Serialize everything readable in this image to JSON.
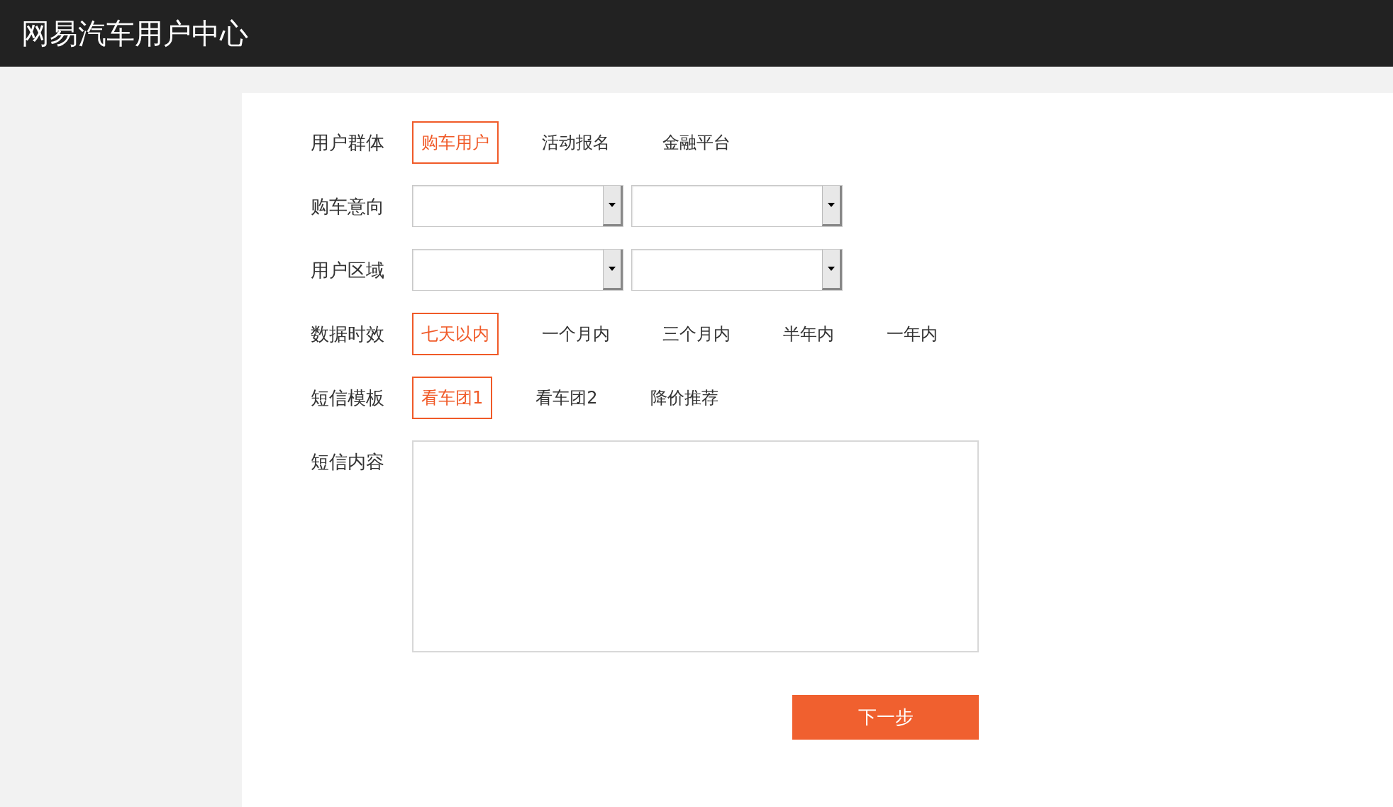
{
  "header": {
    "title": "网易汽车用户中心"
  },
  "form": {
    "rows": [
      {
        "label": "用户群体",
        "kind": "options",
        "options": [
          {
            "label": "购车用户",
            "selected": true
          },
          {
            "label": "活动报名",
            "selected": false
          },
          {
            "label": "金融平台",
            "selected": false
          }
        ]
      },
      {
        "label": "购车意向",
        "kind": "selects",
        "fields": [
          {
            "kind": "dropdown"
          },
          {
            "kind": "dropdown"
          }
        ]
      },
      {
        "label": "用户区域",
        "kind": "selects",
        "fields": [
          {
            "kind": "dropdown"
          },
          {
            "kind": "dropdown"
          }
        ]
      },
      {
        "label": "数据时效",
        "kind": "options",
        "options": [
          {
            "label": "七天以内",
            "selected": true
          },
          {
            "label": "一个月内",
            "selected": false
          },
          {
            "label": "三个月内",
            "selected": false
          },
          {
            "label": "半年内",
            "selected": false
          },
          {
            "label": "一年内",
            "selected": false
          }
        ]
      },
      {
        "label": "短信模板",
        "kind": "options",
        "options": [
          {
            "label": "看车团1",
            "selected": true
          },
          {
            "label": "看车团2",
            "selected": false
          },
          {
            "label": "降价推荐",
            "selected": false
          }
        ]
      },
      {
        "label": "短信内容",
        "kind": "textarea"
      }
    ],
    "submit": "下一步"
  }
}
